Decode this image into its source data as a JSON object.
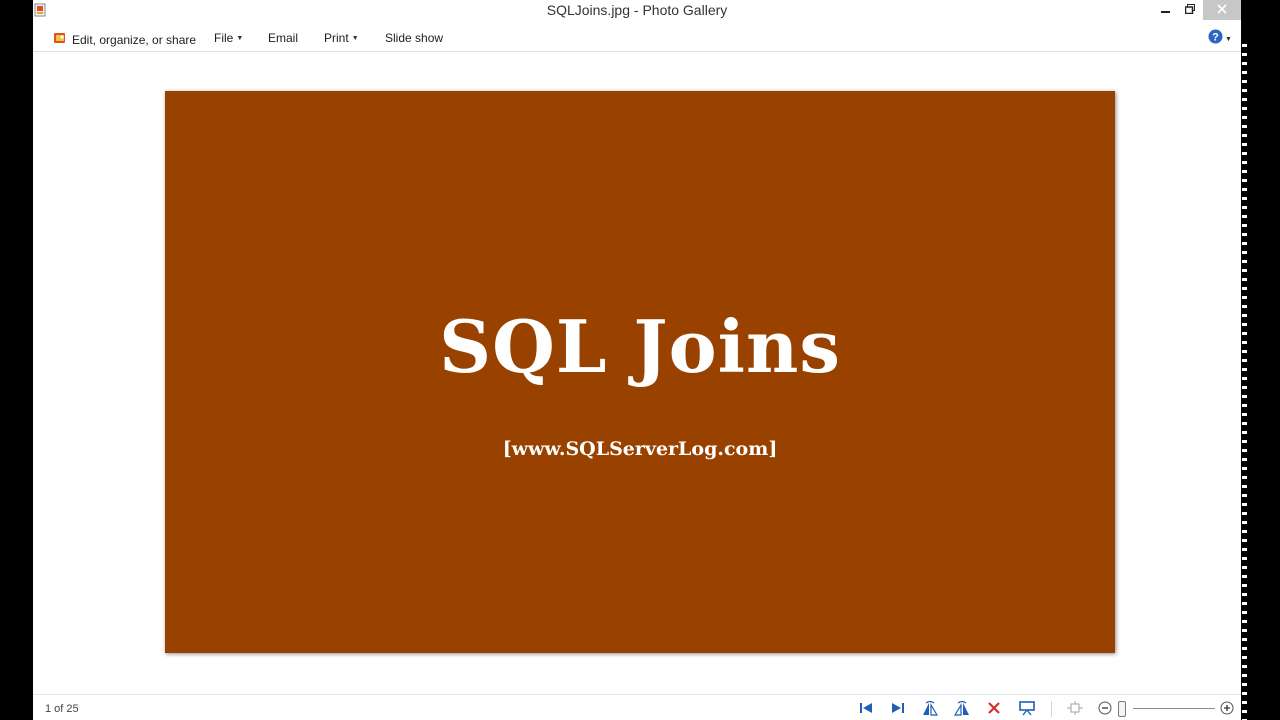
{
  "window": {
    "title": "SQLJoins.jpg - Photo Gallery",
    "app_icon": "photo-gallery-app-icon",
    "controls": [
      "minimize-icon",
      "restore-icon",
      "close-icon"
    ]
  },
  "menubar": {
    "items": [
      {
        "label": "Edit, organize, or share",
        "icon": "photo-gallery-icon",
        "has_dropdown": false
      },
      {
        "label": "File",
        "has_dropdown": true
      },
      {
        "label": "Email",
        "has_dropdown": false
      },
      {
        "label": "Print",
        "has_dropdown": true
      },
      {
        "label": "Slide show",
        "has_dropdown": false
      }
    ],
    "help_icon": "help-icon"
  },
  "photo": {
    "title": "SQL Joins",
    "subtitle": "[www.SQLServerLog.com]",
    "background_color": "#994200",
    "text_color": "#ffffff"
  },
  "statusbar": {
    "position_text": "1 of 25",
    "controls": [
      "previous-icon",
      "next-icon",
      "rotate-left-icon",
      "rotate-right-icon",
      "delete-icon",
      "slideshow-icon",
      "actual-size-icon",
      "zoom-out-icon",
      "zoom-in-icon"
    ],
    "accent_color": "#1f5fb8",
    "delete_color": "#d32f2f"
  }
}
